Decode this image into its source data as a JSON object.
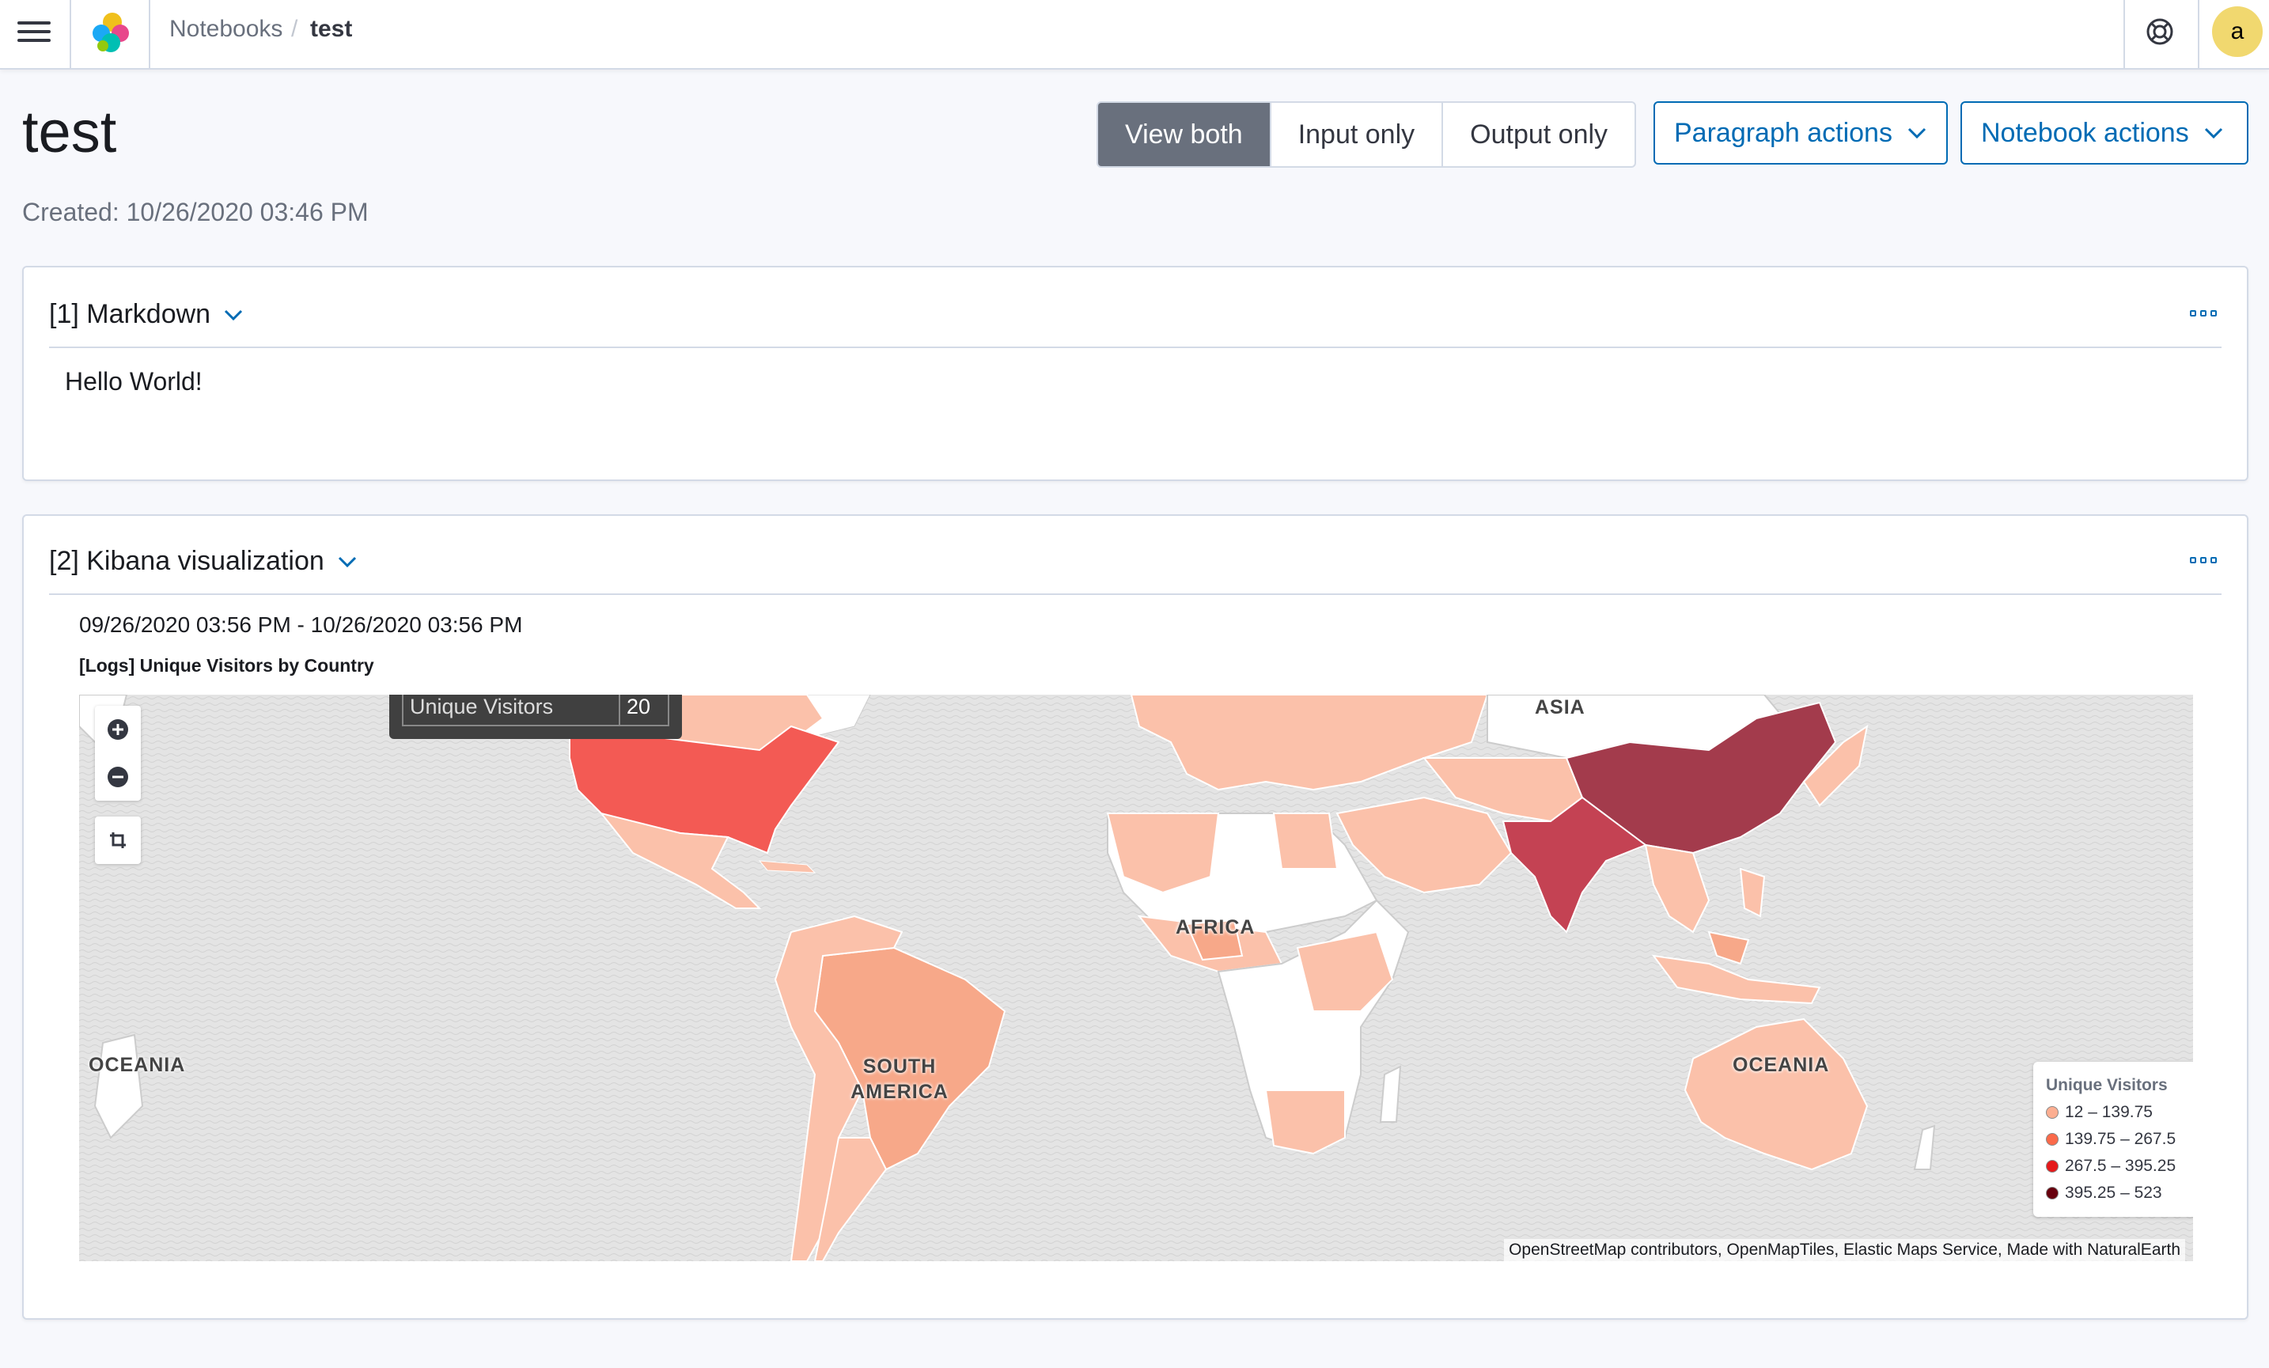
{
  "header": {
    "breadcrumb_root": "Notebooks",
    "breadcrumb_sep": "/",
    "breadcrumb_current": "test",
    "avatar_initial": "a",
    "icons": [
      "menu-icon",
      "elastic-logo",
      "help-icon"
    ]
  },
  "page": {
    "title": "test",
    "created": "Created: 10/26/2020 03:46 PM",
    "view_modes": [
      "View both",
      "Input only",
      "Output only"
    ],
    "selected_view": "View both",
    "paragraph_actions": "Paragraph actions",
    "notebook_actions": "Notebook actions"
  },
  "paragraphs": [
    {
      "title": "[1] Markdown",
      "output": "Hello World!"
    },
    {
      "title": "[2] Kibana visualization",
      "date_range": "09/26/2020 03:56 PM - 10/26/2020 03:56 PM",
      "viz_title": "[Logs] Unique Visitors by Country"
    }
  ],
  "map": {
    "tooltip_label": "Unique Visitors",
    "tooltip_value": "20",
    "continent_labels": [
      "ASIA",
      "AFRICA",
      "SOUTH AMERICA",
      "OCEANIA",
      "OCEANIA"
    ],
    "legend_title": "Unique Visitors",
    "legend": [
      {
        "range": "12 – 139.75",
        "color": "#fcae91"
      },
      {
        "range": "139.75 – 267.5",
        "color": "#fb6a4a"
      },
      {
        "range": "267.5 – 395.25",
        "color": "#e5191b"
      },
      {
        "range": "395.25 – 523",
        "color": "#67000d"
      }
    ],
    "attribution": "OpenStreetMap contributors, OpenMapTiles, Elastic Maps Service, Made with NaturalEarth"
  },
  "colors": {
    "accent": "#006bb4",
    "selected_segment": "#69707d",
    "avatar": "#f1d86f",
    "high_country": "#a33b4c",
    "usa": "#f35a54",
    "low_country": "#fbc1aa"
  }
}
